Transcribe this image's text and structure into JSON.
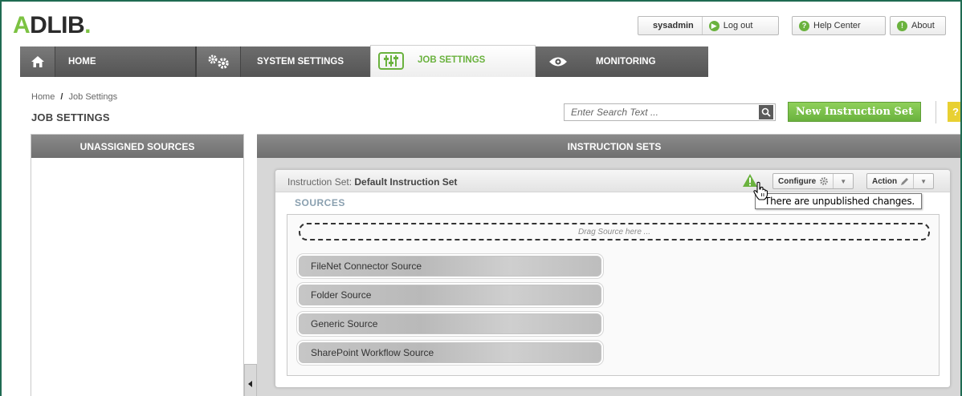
{
  "brand": {
    "logo": "ADLIB.",
    "logo_a": "A",
    "logo_rest": "DLIB",
    "logo_dot": ".",
    "accent": "#7cc242"
  },
  "topbar": {
    "user": "sysadmin",
    "logout_label": "Log out",
    "help_label": "Help Center",
    "about_label": "About"
  },
  "nav": {
    "items": [
      {
        "label": "HOME",
        "icon": "home-icon"
      },
      {
        "label": "SYSTEM SETTINGS",
        "icon": "gears-icon"
      },
      {
        "label": "JOB SETTINGS",
        "icon": "sliders-icon",
        "active": true
      },
      {
        "label": "MONITORING",
        "icon": "eye-icon"
      }
    ]
  },
  "breadcrumb": {
    "home": "Home",
    "separator": "/",
    "current": "Job Settings"
  },
  "page": {
    "title": "JOB SETTINGS"
  },
  "search": {
    "placeholder": "Enter Search Text ..."
  },
  "actions": {
    "new_instruction_set": "New Instruction Set",
    "help": "?"
  },
  "left_panel": {
    "title": "UNASSIGNED SOURCES"
  },
  "right_panel": {
    "title": "INSTRUCTION SETS"
  },
  "instruction_set": {
    "prefix": "Instruction Set:",
    "name": "Default Instruction Set",
    "configure_label": "Configure",
    "action_label": "Action",
    "warning_tooltip": "There are unpublished changes.",
    "sources_label": "SOURCES",
    "drop_hint": "Drag Source here ...",
    "sources": [
      "FileNet Connector Source",
      "Folder Source",
      "Generic Source",
      "SharePoint Workflow Source"
    ]
  }
}
